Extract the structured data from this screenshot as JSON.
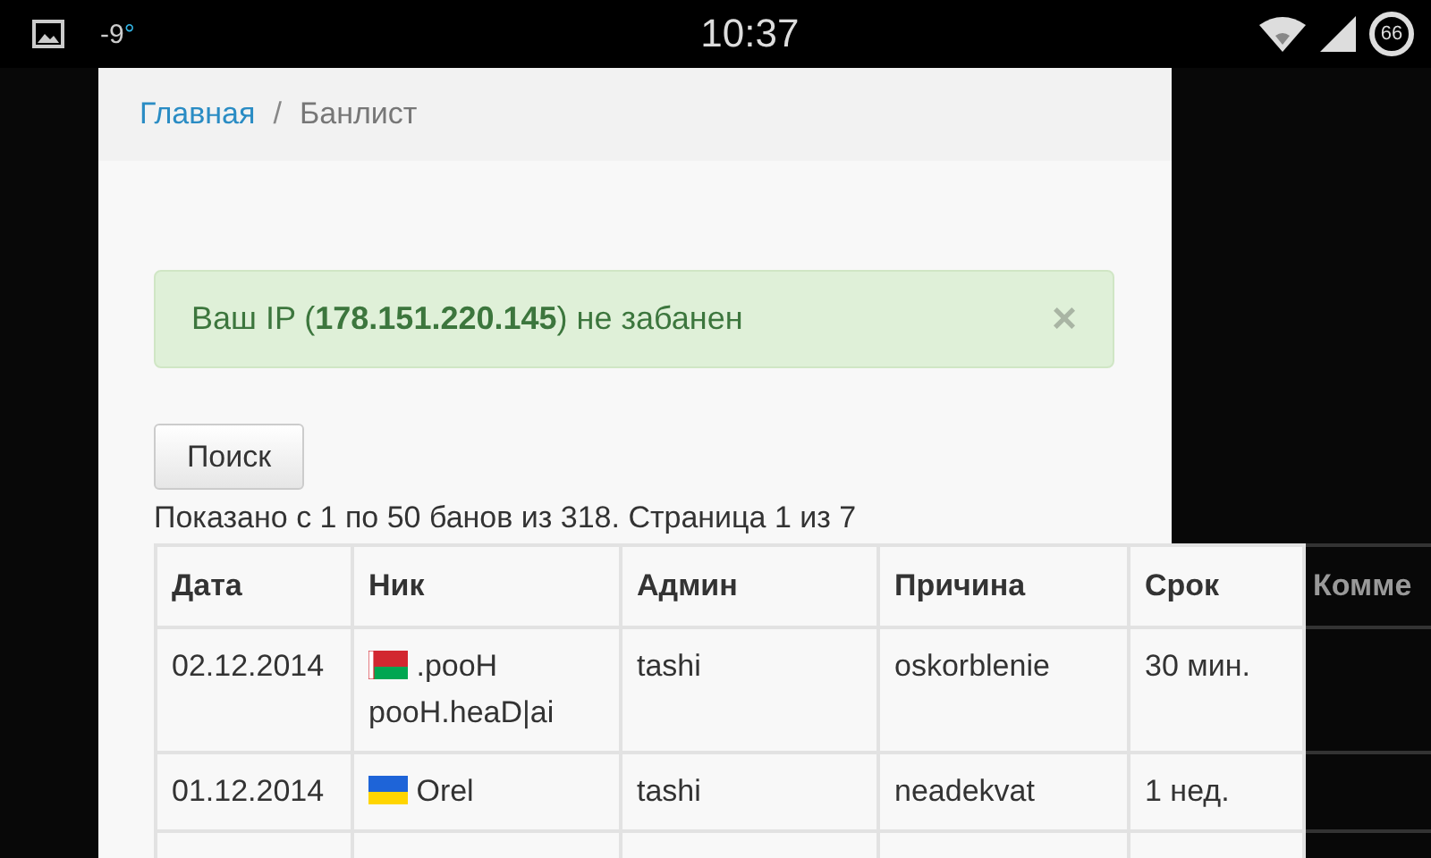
{
  "status_bar": {
    "temperature": "-9",
    "degree": "°",
    "time": "10:37",
    "battery": "66"
  },
  "breadcrumb_separator": "/",
  "breadcrumb": [
    {
      "label": "Главная",
      "selected": false
    },
    {
      "label": "Банлист",
      "selected": true
    }
  ],
  "alert": {
    "text": "Ваш IP (**178.151.220.145**) не забанен",
    "close": "×"
  },
  "search_button": "Поиск",
  "summary": "Показано с 1 по 50 банов из 318. Страница 1 из 7",
  "table": {
    "columns": [
      "Дата",
      "Ник",
      "Админ",
      "Причина",
      "Срок",
      "Комме"
    ],
    "rows": [
      {
        "date": "02.12.2014",
        "kind": "belarus",
        "nick": ".pooH pooH.heaD|ai",
        "admin": "tashi",
        "reason": "oskorblenie",
        "term": "30 мин."
      },
      {
        "date": "01.12.2014",
        "kind": "ukraine",
        "nick": "Orel",
        "admin": "tashi",
        "reason": "neadekvat",
        "term": "1 нед."
      }
    ]
  }
}
